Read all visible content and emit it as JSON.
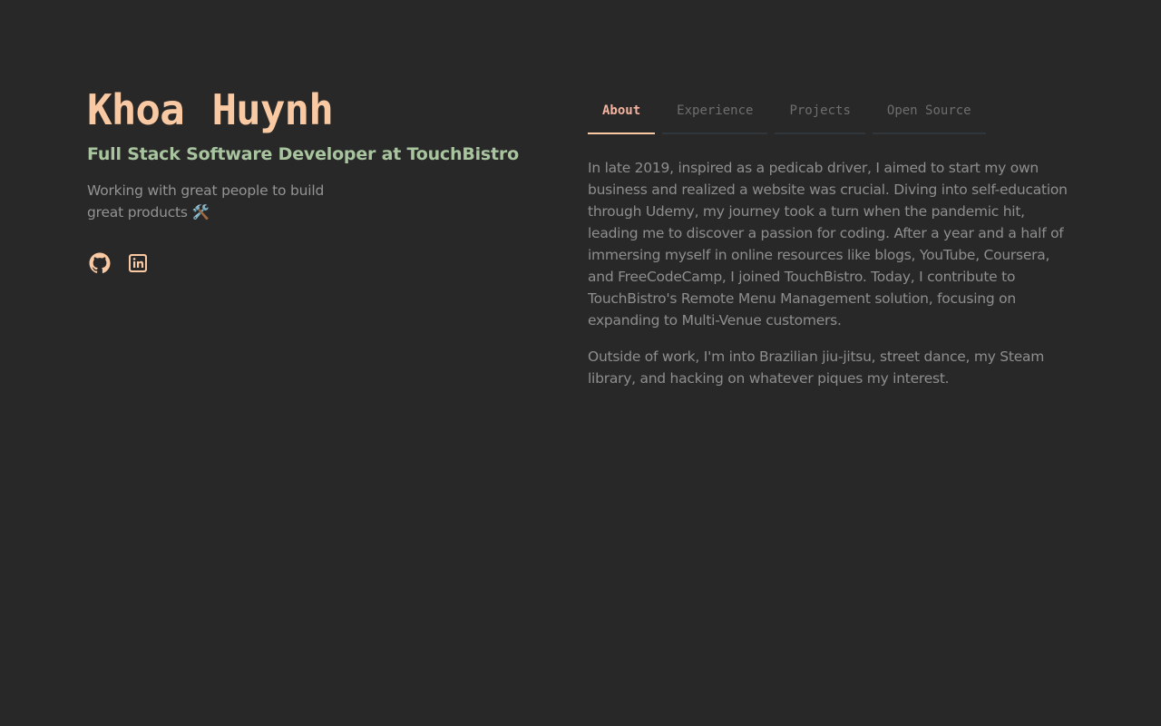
{
  "profile": {
    "name": "Khoa Huynh",
    "role": "Full Stack Software Developer at TouchBistro",
    "tagline": "Working with great people to build great products 🛠️"
  },
  "socials": [
    {
      "icon": "github-icon"
    },
    {
      "icon": "linkedin-icon"
    }
  ],
  "tabs": [
    {
      "label": "About",
      "active": true
    },
    {
      "label": "Experience",
      "active": false
    },
    {
      "label": "Projects",
      "active": false
    },
    {
      "label": "Open Source",
      "active": false
    }
  ],
  "about": {
    "paragraphs": [
      "In late 2019, inspired as a pedicab driver, I aimed to start my own business and realized a website was crucial. Diving into self-education through Udemy, my journey took a turn when the pandemic hit, leading me to discover a passion for coding. After a year and a half of immersing myself in online resources like blogs, YouTube, Coursera, and FreeCodeCamp, I joined TouchBistro. Today, I contribute to TouchBistro's Remote Menu Management solution, focusing on expanding to Multi-Venue customers.",
      "Outside of work, I'm into Brazilian jiu-jitsu, street dance, my Steam library, and hacking on whatever piques my interest."
    ]
  },
  "colors": {
    "background": "#282828",
    "accent": "#f8c9a3",
    "role": "#a9c59f",
    "text": "#8e8e8e",
    "active_tab": "#f5b3a0",
    "inactive_tab": "#6e6e6e"
  }
}
